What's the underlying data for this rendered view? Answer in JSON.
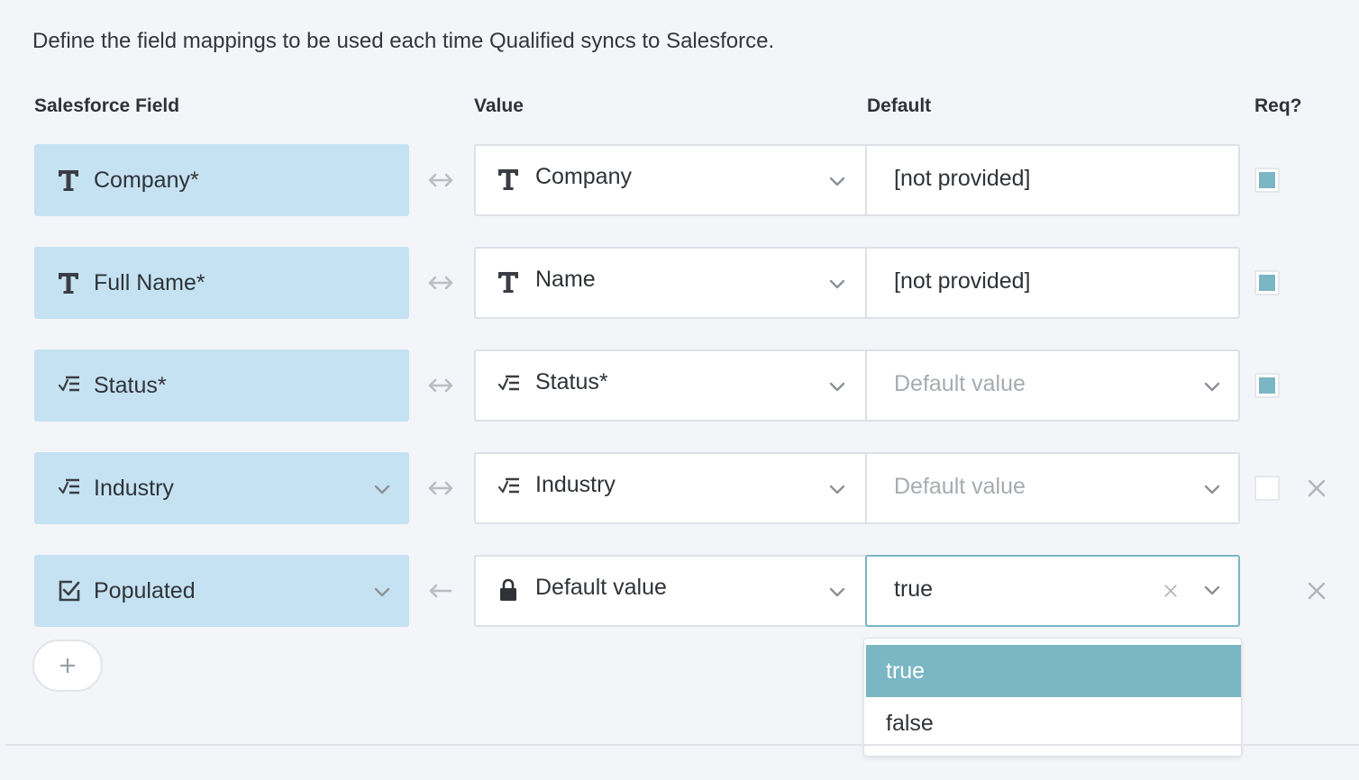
{
  "intro": "Define the field mappings to be used each time Qualified syncs to Salesforce.",
  "headers": {
    "salesforce_field": "Salesforce Field",
    "value": "Value",
    "default": "Default",
    "required": "Req?"
  },
  "rows": [
    {
      "sf_label": "Company*",
      "sf_icon": "text-type-icon",
      "sf_dropdown": false,
      "direction": "bidirectional-arrow-icon",
      "value_label": "Company",
      "value_icon": "text-type-icon",
      "default_text": "[not provided]",
      "default_placeholder": false,
      "default_dropdown": false,
      "required": true,
      "show_checkbox": true,
      "removable": false
    },
    {
      "sf_label": "Full Name*",
      "sf_icon": "text-type-icon",
      "sf_dropdown": false,
      "direction": "bidirectional-arrow-icon",
      "value_label": "Name",
      "value_icon": "text-type-icon",
      "default_text": "[not provided]",
      "default_placeholder": false,
      "default_dropdown": false,
      "required": true,
      "show_checkbox": true,
      "removable": false
    },
    {
      "sf_label": "Status*",
      "sf_icon": "picklist-icon",
      "sf_dropdown": false,
      "direction": "bidirectional-arrow-icon",
      "value_label": "Status*",
      "value_icon": "picklist-icon",
      "default_text": "Default value",
      "default_placeholder": true,
      "default_dropdown": true,
      "required": true,
      "show_checkbox": true,
      "removable": false
    },
    {
      "sf_label": "Industry",
      "sf_icon": "picklist-icon",
      "sf_dropdown": true,
      "direction": "bidirectional-arrow-icon",
      "value_label": "Industry",
      "value_icon": "picklist-icon",
      "default_text": "Default value",
      "default_placeholder": true,
      "default_dropdown": true,
      "required": false,
      "show_checkbox": true,
      "removable": true
    },
    {
      "sf_label": "Populated",
      "sf_icon": "checkbox-type-icon",
      "sf_dropdown": true,
      "direction": "left-arrow-icon",
      "value_label": "Default value",
      "value_icon": "lock-icon",
      "default_text": "true",
      "default_placeholder": false,
      "default_dropdown": true,
      "required": false,
      "show_checkbox": false,
      "removable": true
    }
  ],
  "add_button": {
    "icon": "plus-icon"
  },
  "dropdown_options": [
    "true",
    "false"
  ],
  "dropdown_selected": "true",
  "colors": {
    "background": "#f3f5f9",
    "sf_field_bg": "#c5e2f3",
    "accent": "#7ab6c3",
    "text": "#2f3338",
    "placeholder": "#a7abb0"
  }
}
